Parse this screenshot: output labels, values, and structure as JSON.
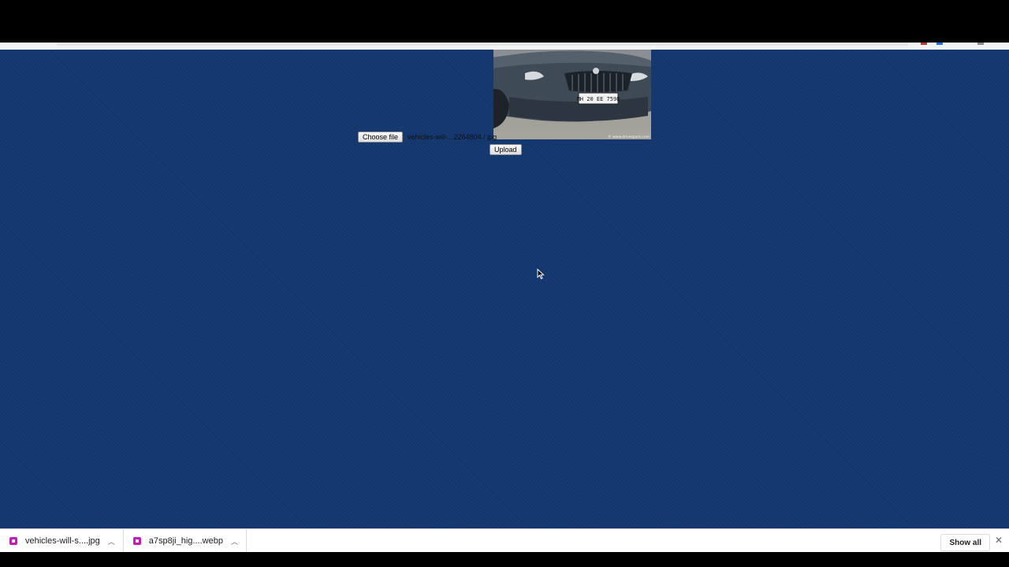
{
  "page": {
    "background_color": "#163a74"
  },
  "form": {
    "choose_file_label": "Choose file",
    "selected_file_name": "vehicles-will-...2264804 / jpg",
    "upload_label": "Upload"
  },
  "preview": {
    "plate_text": "MH 20 EE 7598",
    "watermark": "© www.drivespark.com"
  },
  "downloads": {
    "items": [
      {
        "label": "vehicles-will-s....jpg",
        "icon": "image-file-icon",
        "icon_color": "#c01fb6"
      },
      {
        "label": "a7sp8ji_hig....webp",
        "icon": "image-file-icon",
        "icon_color": "#c01fb6"
      }
    ],
    "show_all_label": "Show all",
    "close_symbol": "✕"
  }
}
